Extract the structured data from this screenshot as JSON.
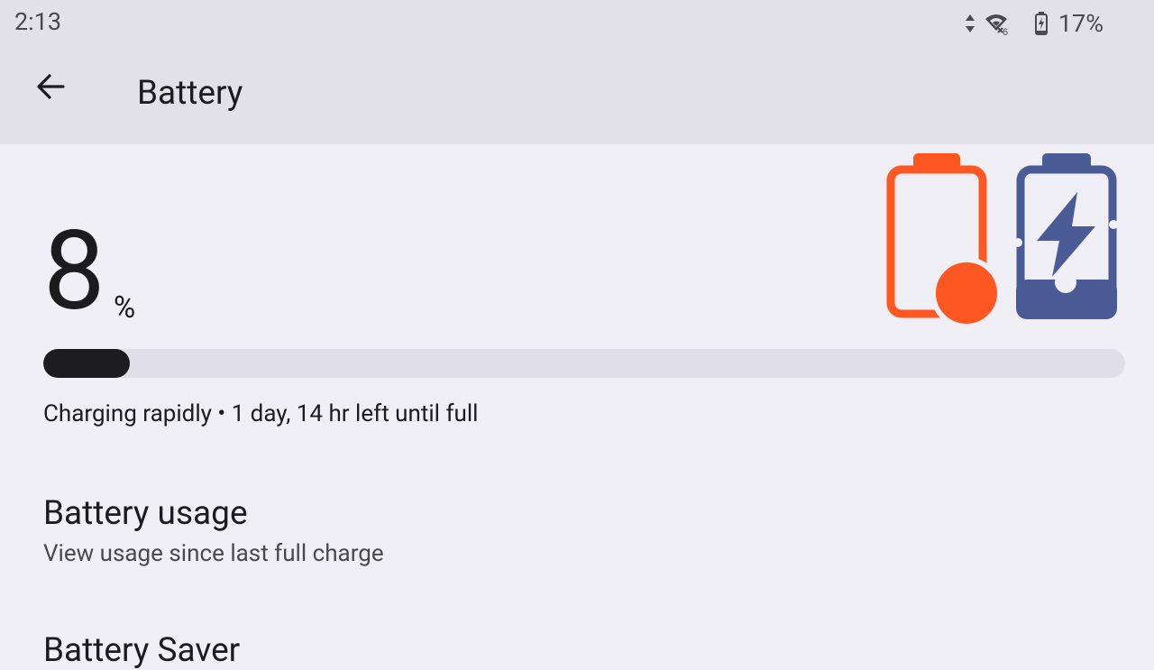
{
  "status_bar": {
    "time": "2:13",
    "battery_percent": "17%",
    "icons": [
      "data-arrows-icon",
      "wifi-6-icon",
      "battery-charging-icon"
    ]
  },
  "app_bar": {
    "title": "Battery",
    "back_icon": "arrow-back-icon"
  },
  "battery": {
    "level": "8",
    "percent_sign": "%",
    "progress_fraction": 0.08,
    "status_line": "Charging rapidly • 1 day, 14 hr left until full",
    "illustration": "battery-charging-illustration"
  },
  "preferences": [
    {
      "title": "Battery usage",
      "summary": "View usage since last full charge"
    },
    {
      "title": "Battery Saver"
    }
  ],
  "colors": {
    "header_bg": "#e2e1e7",
    "page_bg": "#f0eff5",
    "accent_orange": "#ff5722",
    "accent_blue": "#4a5b96",
    "progress_fill": "#1d1c21",
    "progress_track": "#e0dfe7"
  }
}
